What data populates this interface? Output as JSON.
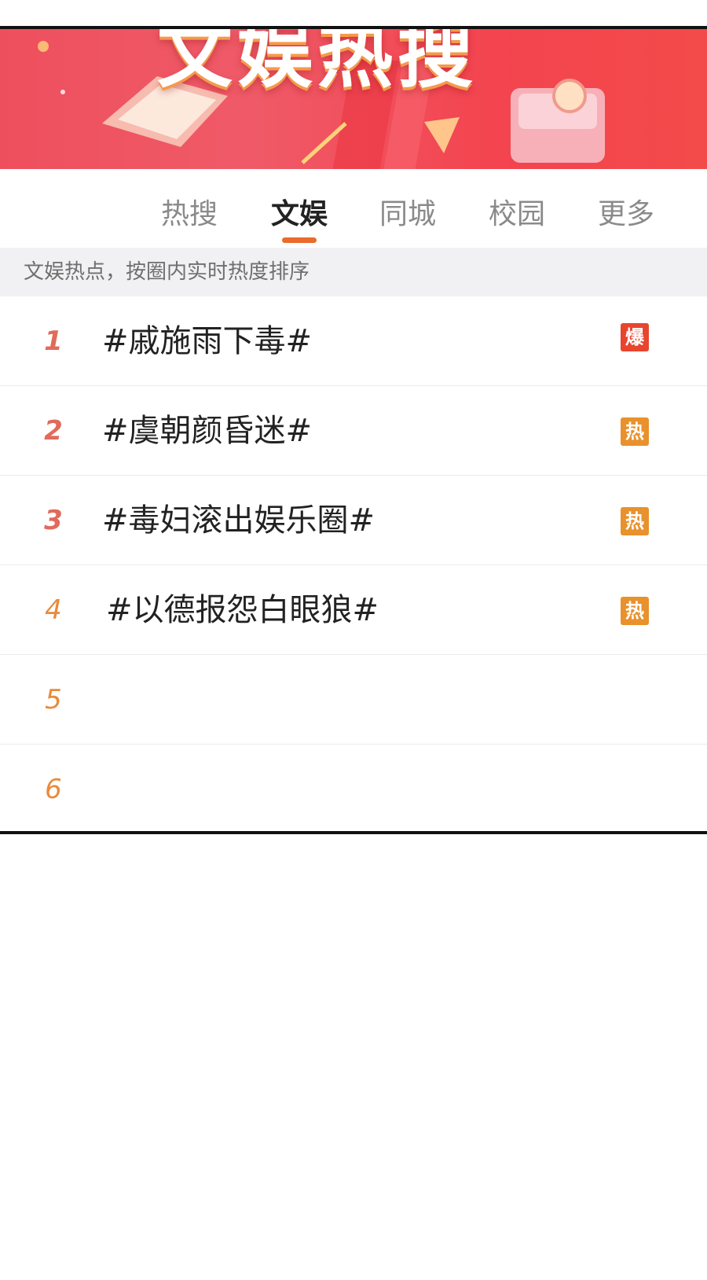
{
  "banner": {
    "title": "文娱热搜"
  },
  "tabs": [
    {
      "label": "热搜",
      "active": false
    },
    {
      "label": "文娱",
      "active": true
    },
    {
      "label": "同城",
      "active": false
    },
    {
      "label": "校园",
      "active": false
    },
    {
      "label": "更多",
      "active": false
    }
  ],
  "subheader": "文娱热点，按圈内实时热度排序",
  "items": [
    {
      "rank": "1",
      "title": "#戚施雨下毒#",
      "badge": "爆"
    },
    {
      "rank": "2",
      "title": "#虞朝颜昏迷#",
      "badge": "热"
    },
    {
      "rank": "3",
      "title": "#毒妇滚出娱乐圈#",
      "badge": "热"
    },
    {
      "rank": "4",
      "title": "#以德报怨白眼狼#",
      "badge": "热"
    },
    {
      "rank": "5",
      "title": "",
      "badge": ""
    },
    {
      "rank": "6",
      "title": "",
      "badge": ""
    }
  ],
  "colors": {
    "accent": "#ea6b2c",
    "banner": "#ee4f5d",
    "badge_bao": "#e8452f",
    "badge_re": "#e8912d"
  }
}
